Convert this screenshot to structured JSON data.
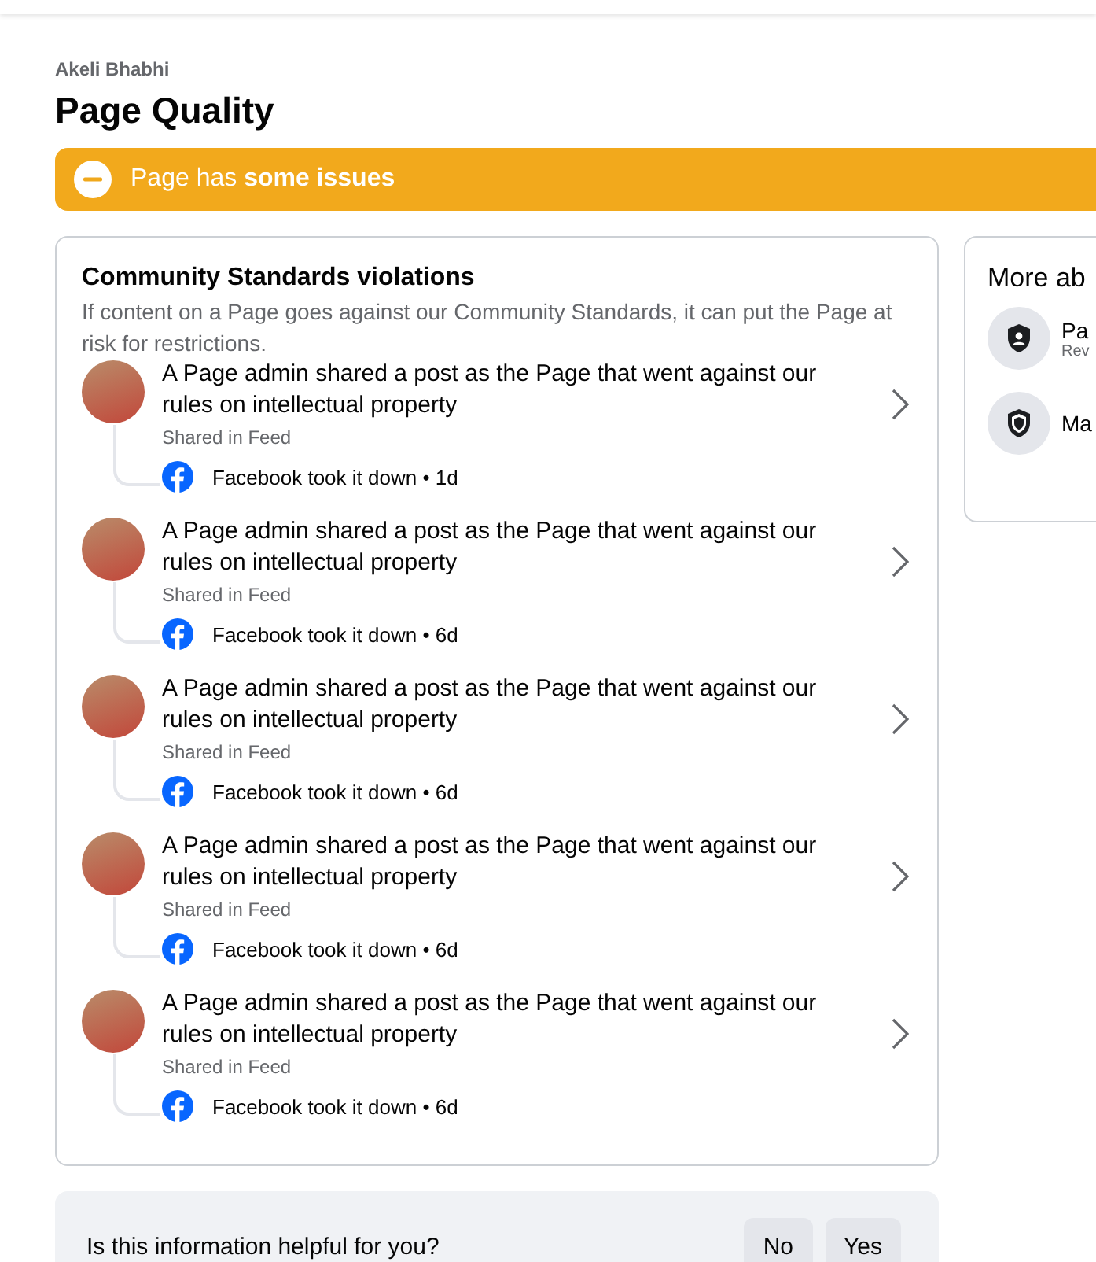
{
  "page_name": "Akeli Bhabhi",
  "title": "Page Quality",
  "status_banner": {
    "text": "Page has **some issues**"
  },
  "violations": {
    "heading": "Community Standards violations",
    "description": "If content on a Page goes against our Community Standards, it can put the Page at risk for restrictions.",
    "items": [
      {
        "title": "A Page admin shared a post as the Page that went against our rules on intellectual property",
        "location": "Shared in Feed",
        "action": "Facebook took it down • 1d"
      },
      {
        "title": "A Page admin shared a post as the Page that went against our rules on intellectual property",
        "location": "Shared in Feed",
        "action": "Facebook took it down • 6d"
      },
      {
        "title": "A Page admin shared a post as the Page that went against our rules on intellectual property",
        "location": "Shared in Feed",
        "action": "Facebook took it down • 6d"
      },
      {
        "title": "A Page admin shared a post as the Page that went against our rules on intellectual property",
        "location": "Shared in Feed",
        "action": "Facebook took it down • 6d"
      },
      {
        "title": "A Page admin shared a post as the Page that went against our rules on intellectual property",
        "location": "Shared in Feed",
        "action": "Facebook took it down • 6d"
      }
    ]
  },
  "more_about": {
    "heading": "More ab",
    "items": [
      {
        "kind": "person",
        "title": "Pa",
        "subtitle": "Rev"
      },
      {
        "kind": "shield",
        "title": "Ma"
      }
    ]
  },
  "feedback": {
    "question": "Is this information helpful for you?",
    "buttons": [
      "No",
      "Yes"
    ]
  }
}
